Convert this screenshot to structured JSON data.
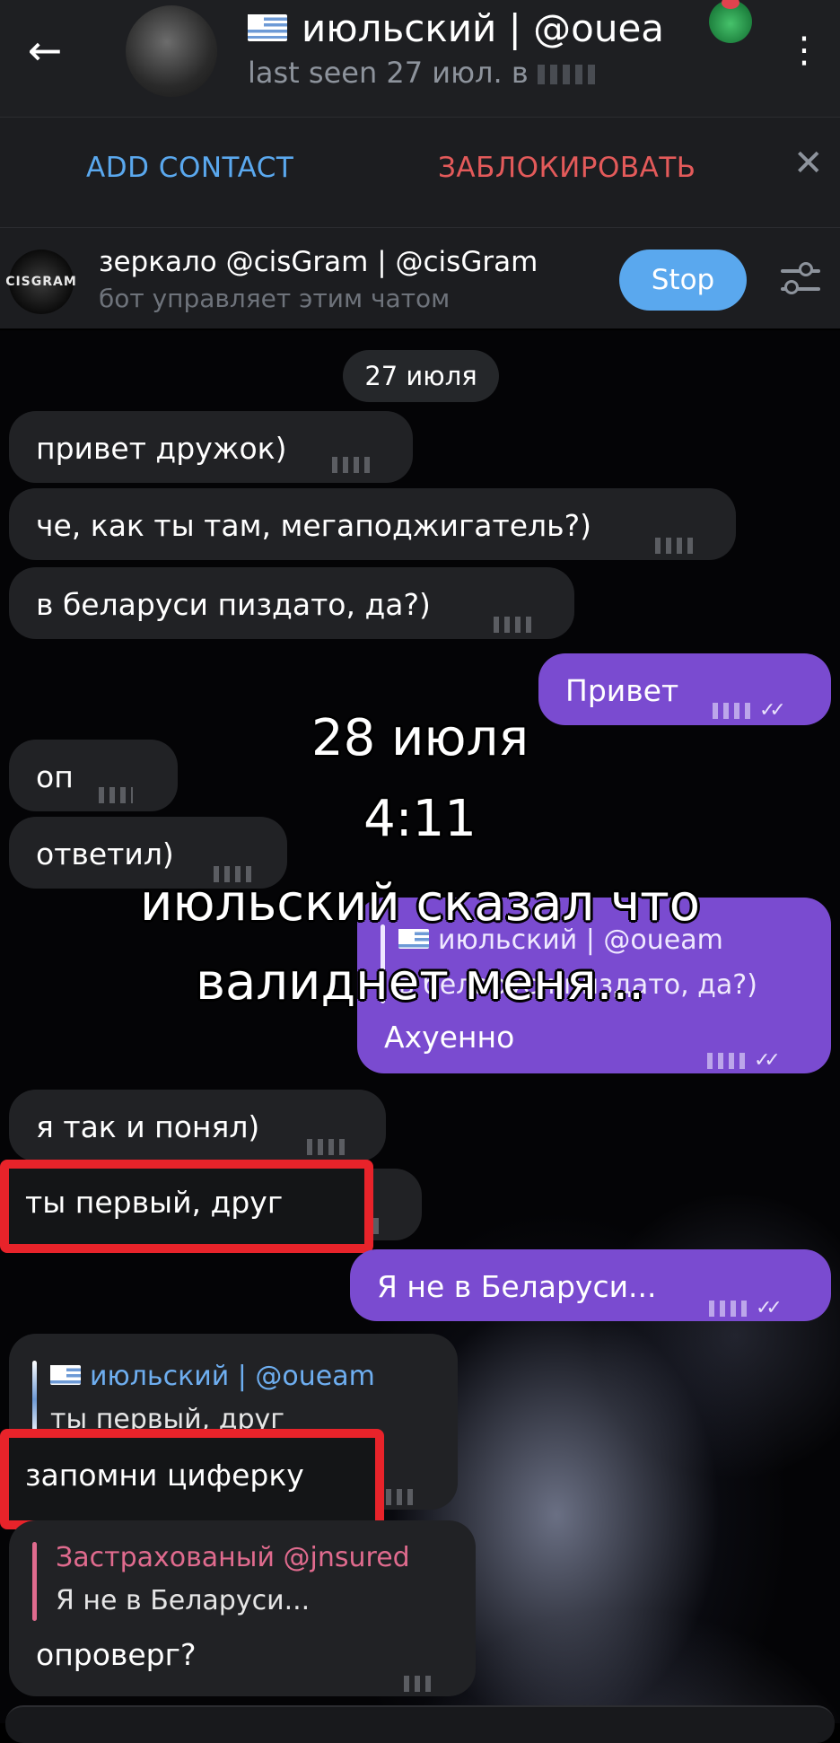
{
  "header": {
    "title": "июльский | @oueа",
    "status": "last seen 27 июл. в",
    "more_icon": "⋮",
    "back_icon": "←"
  },
  "actions": {
    "add_contact": "ADD CONTACT",
    "block": "ЗАБЛОКИРОВАТЬ",
    "close_icon": "✕"
  },
  "bot_bar": {
    "logo_text": "CISGRAM",
    "title": "зеркало @cisGram | @cisGram",
    "subtitle": "бот управляет этим чатом",
    "stop_label": "Stop"
  },
  "chat": {
    "date_separator": "27 июля",
    "messages": [
      {
        "text": "привет дружок)"
      },
      {
        "text": "че, как ты там, мегаподжигатель?)"
      },
      {
        "text": "в беларуси пиздато, да?)"
      },
      {
        "text": "Привет"
      },
      {
        "text": "оп"
      },
      {
        "text": "ответил)"
      },
      {
        "reply_name": "июльский | @oueam",
        "reply_text": "в беларуси пиздато, да?)",
        "text": "Ахуенно"
      },
      {
        "text": "я так и понял)"
      },
      {
        "text": "ты первый, друг"
      },
      {
        "text": "Я не в Беларуси..."
      },
      {
        "reply_name": "июльский | @oueam",
        "reply_text": "ты первый, друг",
        "text": "запомни циферку"
      },
      {
        "reply_name": "Застрахованый @jnsured",
        "reply_text": "Я не в Беларуси...",
        "text": "опроверг?"
      }
    ]
  },
  "overlay": {
    "line1": "28 июля",
    "line2": "4:11",
    "line3": "июльский сказал что",
    "line4": "валиднет меня..."
  },
  "colors": {
    "accent_blue": "#5aa8ee",
    "danger_red": "#e35a5a",
    "outgoing_bubble": "#7a4bd0",
    "incoming_bubble": "#212225",
    "highlight_red": "#e8232a"
  }
}
